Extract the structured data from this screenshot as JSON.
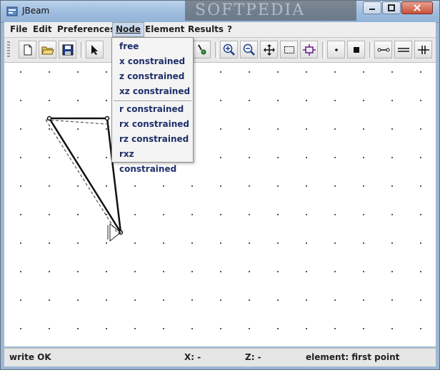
{
  "window": {
    "title": "JBeam",
    "watermark": "SOFTPEDIA"
  },
  "menubar": {
    "items": [
      {
        "label": "File"
      },
      {
        "label": "Edit"
      },
      {
        "label": "Preferences"
      },
      {
        "label": "Node"
      },
      {
        "label": "Element"
      },
      {
        "label": "Results"
      },
      {
        "label": "?"
      }
    ],
    "active": "Node"
  },
  "node_menu": {
    "items": [
      {
        "label": "free"
      },
      {
        "label": "x constrained"
      },
      {
        "label": "z constrained"
      },
      {
        "label": "xz constrained"
      },
      {
        "label": "r constrained"
      },
      {
        "label": "rx constrained"
      },
      {
        "label": "rz constrained"
      },
      {
        "label": "rxz constrained"
      }
    ]
  },
  "toolbar": {
    "buttons": [
      {
        "icon": "new-file-icon"
      },
      {
        "icon": "open-folder-icon"
      },
      {
        "icon": "save-disk-icon"
      },
      {
        "icon": "select-arrow-icon"
      },
      {
        "icon": "node-tool-icon"
      },
      {
        "icon": "zoom-in-icon"
      },
      {
        "icon": "zoom-out-icon"
      },
      {
        "icon": "pan-move-icon"
      },
      {
        "icon": "zoom-window-icon"
      },
      {
        "icon": "zoom-fit-icon"
      },
      {
        "icon": "free-node-icon"
      },
      {
        "icon": "fixed-node-icon"
      },
      {
        "icon": "beam-element-icon"
      },
      {
        "icon": "truss-element-icon"
      },
      {
        "icon": "spring-element-icon"
      }
    ]
  },
  "status": {
    "message": "write OK",
    "x": "X: -",
    "z": "Z: -",
    "element": "element: first point"
  }
}
